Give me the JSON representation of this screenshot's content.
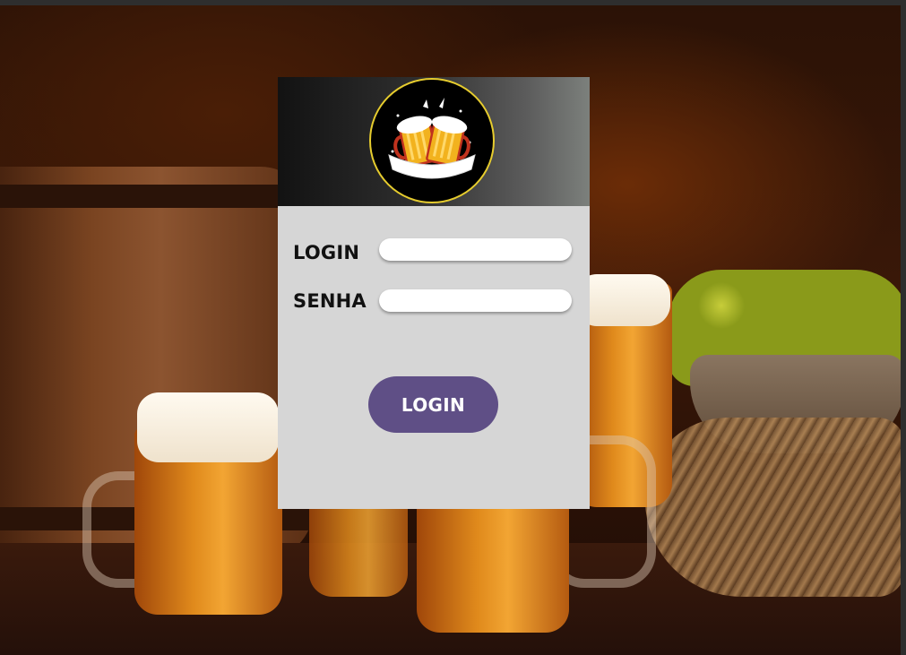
{
  "form": {
    "login_label": "LOGIN",
    "login_value": "",
    "senha_label": "SENHA",
    "senha_value": "",
    "submit_label": "LOGIN"
  },
  "colors": {
    "card_background": "#d6d6d6",
    "button": "#5f4f86",
    "logo_ring": "#e6cc2e"
  },
  "icons": {
    "logo": "beer-mugs-cheers-logo"
  }
}
